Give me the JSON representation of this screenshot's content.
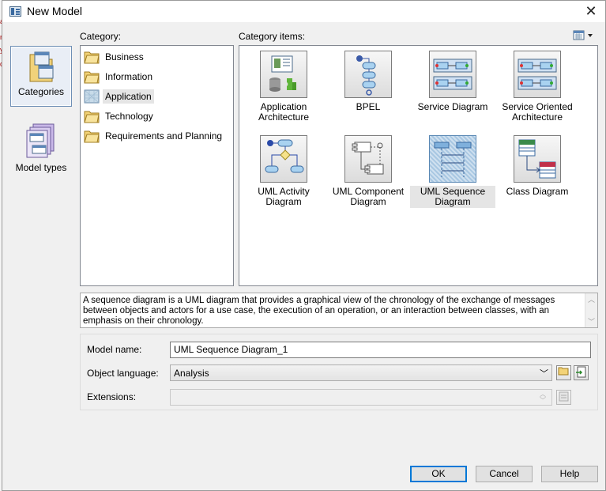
{
  "window": {
    "title": "New Model",
    "close_glyph": "✕"
  },
  "nav": {
    "items": [
      {
        "label": "Categories",
        "selected": true,
        "icon": "categories-icon"
      },
      {
        "label": "Model types",
        "selected": false,
        "icon": "model-types-icon"
      }
    ]
  },
  "category": {
    "label": "Category:",
    "items": [
      {
        "label": "Business",
        "selected": false
      },
      {
        "label": "Information",
        "selected": false
      },
      {
        "label": "Application",
        "selected": true
      },
      {
        "label": "Technology",
        "selected": false
      },
      {
        "label": "Requirements and Planning",
        "selected": false
      }
    ]
  },
  "category_items": {
    "label": "Category items:",
    "view_toggle_icon": "view-options-icon",
    "items": [
      {
        "label": "Application Architecture",
        "icon": "application-architecture-icon",
        "selected": false
      },
      {
        "label": "BPEL",
        "icon": "bpel-icon",
        "selected": false
      },
      {
        "label": "Service Diagram",
        "icon": "service-diagram-icon",
        "selected": false
      },
      {
        "label": "Service Oriented Architecture",
        "icon": "service-oriented-architecture-icon",
        "selected": false
      },
      {
        "label": "UML Activity Diagram",
        "icon": "uml-activity-diagram-icon",
        "selected": false
      },
      {
        "label": "UML Component Diagram",
        "icon": "uml-component-diagram-icon",
        "selected": false
      },
      {
        "label": "UML Sequence Diagram",
        "icon": "uml-sequence-diagram-icon",
        "selected": true
      },
      {
        "label": "Class Diagram",
        "icon": "class-diagram-icon",
        "selected": false
      }
    ]
  },
  "description": "A sequence diagram is a UML diagram that provides a graphical view of the chronology of the exchange of messages between objects and actors for a use case, the execution of an operation, or an interaction between classes, with an emphasis on their chronology.",
  "form": {
    "model_name_label": "Model name:",
    "model_name_value": "UML Sequence Diagram_1",
    "object_language_label": "Object language:",
    "object_language_value": "Analysis",
    "extensions_label": "Extensions:",
    "extensions_value": ""
  },
  "buttons": {
    "ok": "OK",
    "cancel": "Cancel",
    "help": "Help"
  },
  "colors": {
    "dialog_bg": "#f0f0f0",
    "selection": "#e5e5e5",
    "default_button_border": "#0078d7"
  }
}
